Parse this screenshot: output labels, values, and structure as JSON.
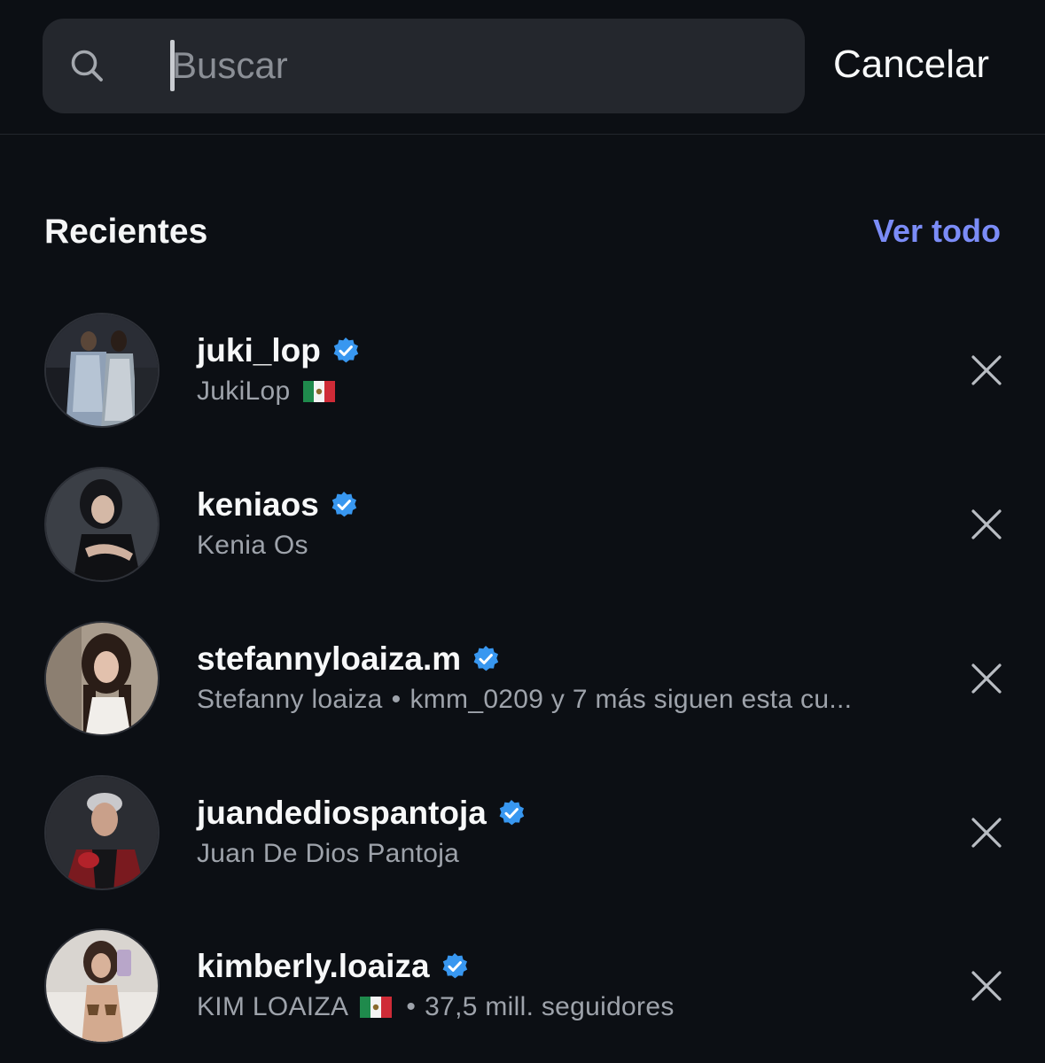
{
  "search": {
    "placeholder": "Buscar",
    "value": ""
  },
  "header": {
    "cancel_label": "Cancelar"
  },
  "recents": {
    "title": "Recientes",
    "see_all_label": "Ver todo",
    "items": [
      {
        "username": "juki_lop",
        "subtitle": "JukiLop",
        "extra": "",
        "flag": "mexico",
        "verified": true
      },
      {
        "username": "keniaos",
        "subtitle": "Kenia Os",
        "extra": "",
        "flag": "",
        "verified": true
      },
      {
        "username": "stefannyloaiza.m",
        "subtitle": "Stefanny loaiza",
        "extra": "kmm_0209 y 7 más siguen esta cu...",
        "flag": "",
        "verified": true
      },
      {
        "username": "juandediospantoja",
        "subtitle": "Juan De Dios Pantoja",
        "extra": "",
        "flag": "",
        "verified": true
      },
      {
        "username": "kimberly.loaiza",
        "subtitle": "KIM LOAIZA",
        "extra": "37,5 mill. seguidores",
        "flag": "mexico",
        "verified": true
      }
    ]
  },
  "colors": {
    "background": "#0c0f14",
    "search_bg": "#24272d",
    "link": "#7b8cf7",
    "verified": "#3897f0",
    "secondary_text": "#9ea3ab"
  },
  "icons": {
    "search": "search-icon",
    "verified": "verified-badge-icon",
    "remove": "close-icon"
  }
}
